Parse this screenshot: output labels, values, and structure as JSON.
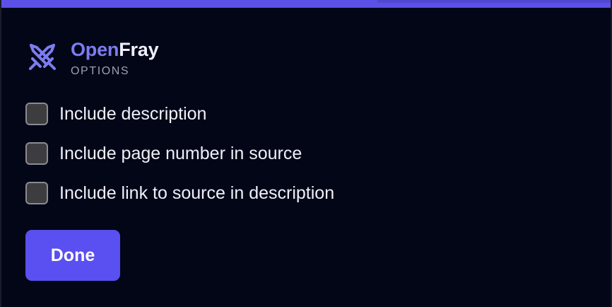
{
  "brand": {
    "name_part1": "Open",
    "name_part2": "Fray",
    "subtitle": "OPTIONS",
    "logo_icon": "crossed-swords-icon"
  },
  "options": [
    {
      "label": "Include description",
      "checked": false
    },
    {
      "label": "Include page number in source",
      "checked": false
    },
    {
      "label": "Include link to source in description",
      "checked": false
    }
  ],
  "done_button": {
    "label": "Done"
  },
  "colors": {
    "accent": "#5a4ff0",
    "background": "#030617",
    "brand_open": "#7c7cf0",
    "text": "#eef0fb",
    "muted": "#9ba0b0"
  }
}
